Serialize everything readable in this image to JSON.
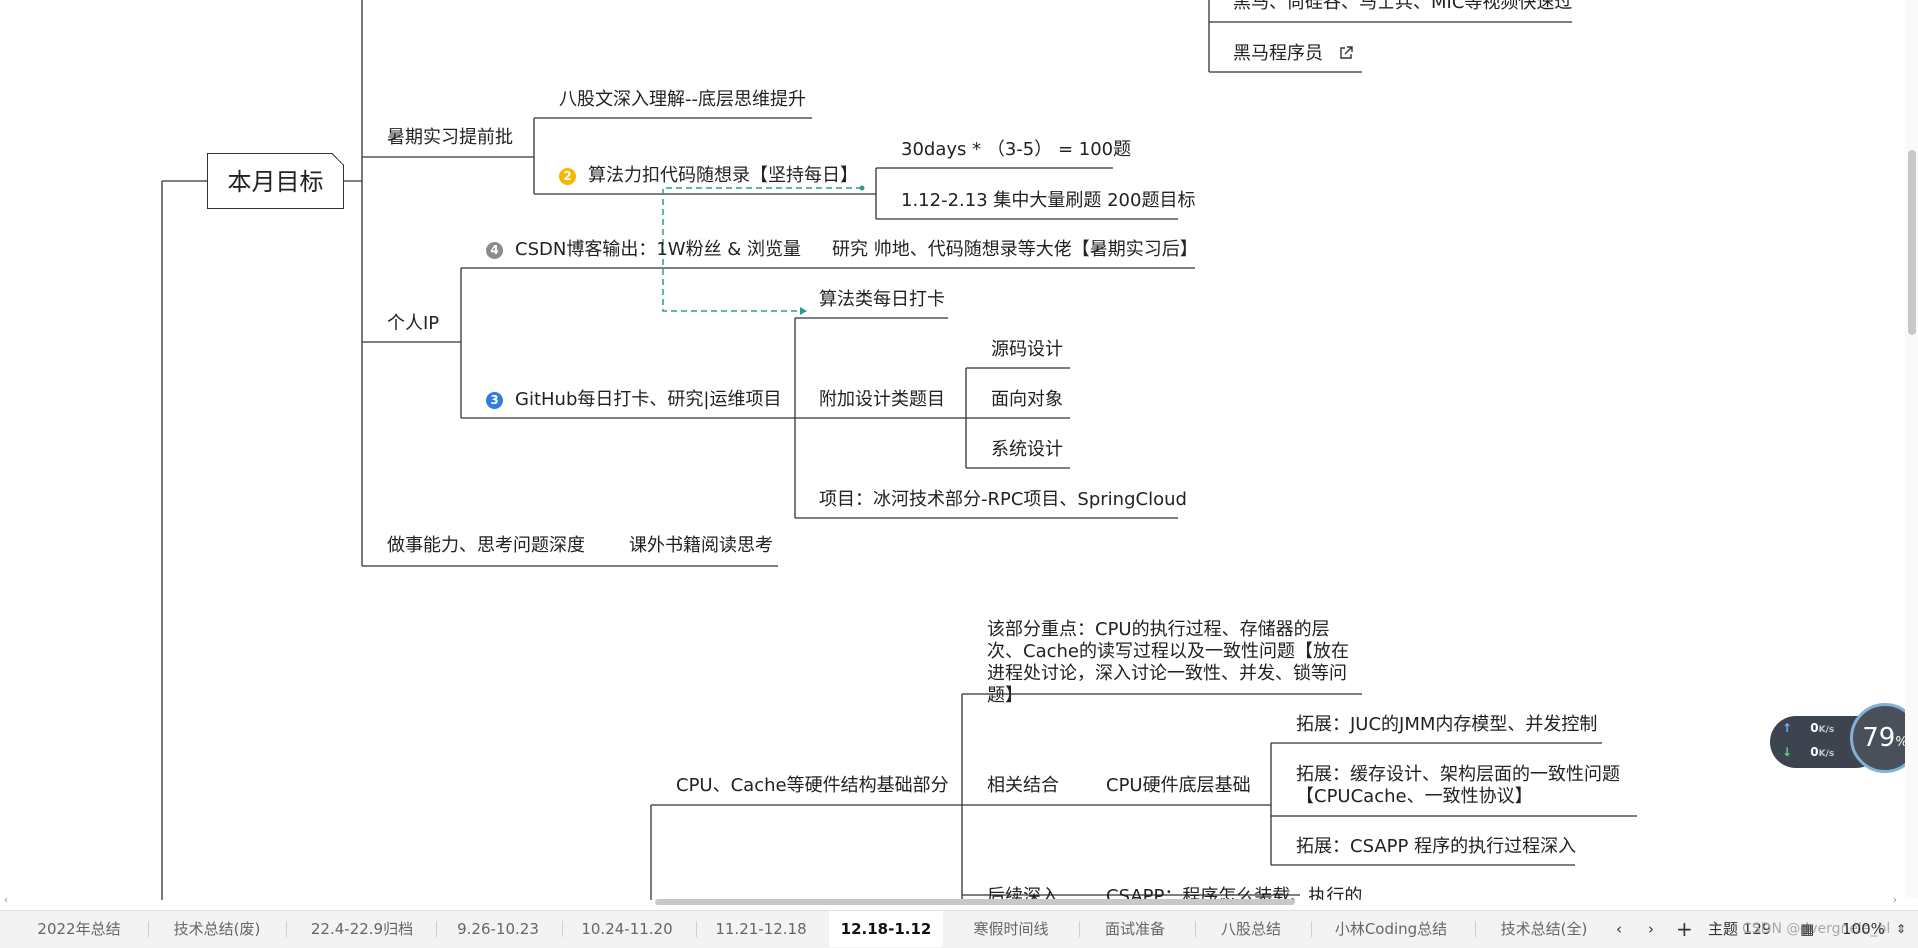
{
  "mindmap": {
    "root": "本月目标",
    "top_cut_text": "黑马、尚硅谷、马士兵、MIC等视频快速过",
    "heima": "黑马程序员",
    "summer_intern": "暑期实习提前批",
    "baguwen": "八股文深入理解--底层思维提升",
    "algo_badge": "2",
    "algo": "算法力扣代码随想录【坚持每日】",
    "days30": "30days * （3-5） = 100题",
    "jan_feb": "1.12-2.13 集中大量刷题 200题目标",
    "personal_ip": "个人IP",
    "csdn_badge": "4",
    "csdn": "CSDN博客输出：1W粉丝 & 浏览量",
    "research": "研究 帅地、代码随想录等大佬【暑期实习后】",
    "algo_daily": "算法类每日打卡",
    "github_badge": "3",
    "github": "GitHub每日打卡、研究|运维项目",
    "design_extra": "附加设计类题目",
    "source_design": "源码设计",
    "oop": "面向对象",
    "system_design": "系统设计",
    "project": "项目：冰河技术部分-RPC项目、SpringCloud",
    "ability": "做事能力、思考问题深度",
    "books": "课外书籍阅读思考",
    "cpu_focus": "该部分重点：CPU的执行过程、存储器的层次、Cache的读写过程以及一致性问题【放在进程处讨论，深入讨论一致性、并发、锁等问题】",
    "cpu_base": "CPU、Cache等硬件结构基础部分",
    "related": "相关结合",
    "cpu_low": "CPU硬件底层基础",
    "ext_juc": "拓展：JUC的JMM内存模型、并发控制",
    "ext_cache": "拓展：缓存设计、架构层面的一致性问题【CPUCache、一致性协议】",
    "ext_csapp": "拓展：CSAPP 程序的执行过程深入",
    "follow_cut": "后续深入",
    "csapp_cut": "CSAPP：程序怎么装载、执行的"
  },
  "network": {
    "up": "0",
    "down": "0",
    "unit": "K/s",
    "cpu": "79",
    "cpu_unit": "%"
  },
  "tabs": [
    "2022年总结",
    "技术总结(废)",
    "22.4-22.9归档",
    "9.26-10.23",
    "10.24-11.20",
    "11.21-12.18",
    "12.18-1.12",
    "寒假时间线",
    "面试准备",
    "八股总结",
    "小林Coding总结",
    "技术总结(全)"
  ],
  "active_tab": "12.18-1.12",
  "controls": {
    "add": "+",
    "topic_label": "主题",
    "topic_count": "129",
    "zoom": "100%"
  },
  "watermark": "CSDN @dvergnele_bl",
  "colors": {
    "badge2": "#f5b800",
    "badge3": "#2f7de1",
    "badge4": "#8c8c8c",
    "dashed": "#2a9d8f",
    "line": "#333333"
  }
}
